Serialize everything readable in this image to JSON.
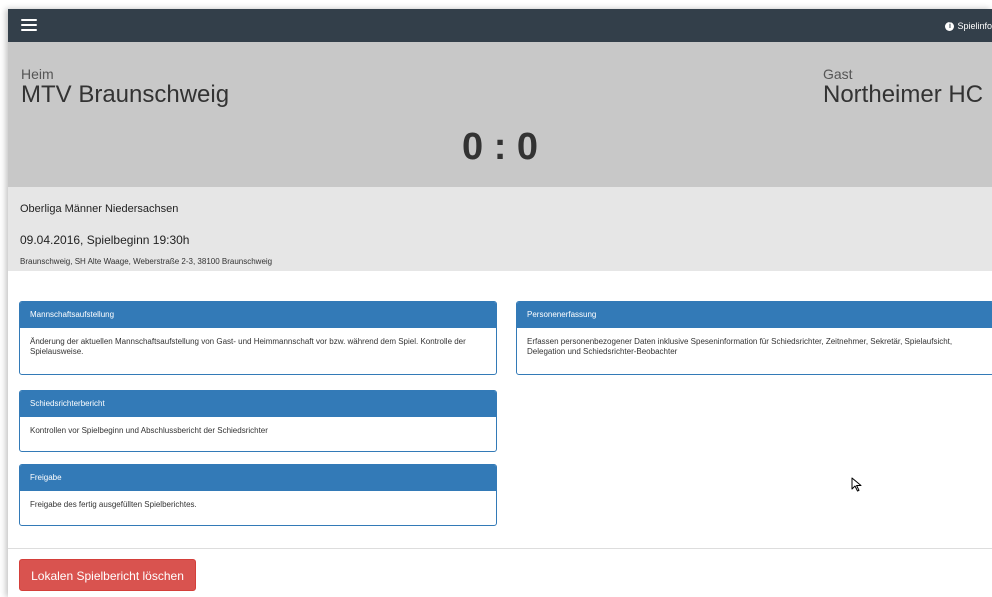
{
  "navbar": {
    "menu_icon": "hamburger-menu-icon",
    "info_icon": "info-circle-icon",
    "info_label": "Spielinfo",
    "background_color": "#333f4a"
  },
  "match": {
    "home_label": "Heim",
    "home_team": "MTV Braunschweig",
    "guest_label": "Gast",
    "guest_team": "Northeimer HC",
    "score": "0 : 0",
    "league": "Oberliga Männer Niedersachsen",
    "datetime": "09.04.2016, Spielbeginn 19:30h",
    "venue": "Braunschweig, SH Alte Waage, Weberstraße 2-3, 38100 Braunschweig"
  },
  "panels": [
    {
      "title": "Mannschaftsaufstellung",
      "body": "Änderung der aktuellen Mannschaftsaufstellung von Gast- und Heimmannschaft vor bzw. während dem Spiel. Kontrolle der Spielausweise."
    },
    {
      "title": "Personenerfassung",
      "body": "Erfassen personenbezogener Daten inklusive Speseninformation für Schiedsrichter, Zeitnehmer, Sekretär, Spielaufsicht, Delegation und Schiedsrichter-Beobachter"
    },
    {
      "title": "Schiedsrichterbericht",
      "body": "Kontrollen vor Spielbeginn und Abschlussbericht der Schiedsrichter"
    },
    {
      "title": "Freigabe",
      "body": "Freigabe des fertig ausgefüllten Spielberichtes."
    }
  ],
  "actions": {
    "delete_label": "Lokalen Spielbericht löschen"
  },
  "colors": {
    "panel_primary": "#337ab7",
    "danger": "#d9534f",
    "score_background": "#c8c8c8",
    "meta_background": "#e6e6e6"
  },
  "cursor_icon": "mouse-pointer-icon"
}
